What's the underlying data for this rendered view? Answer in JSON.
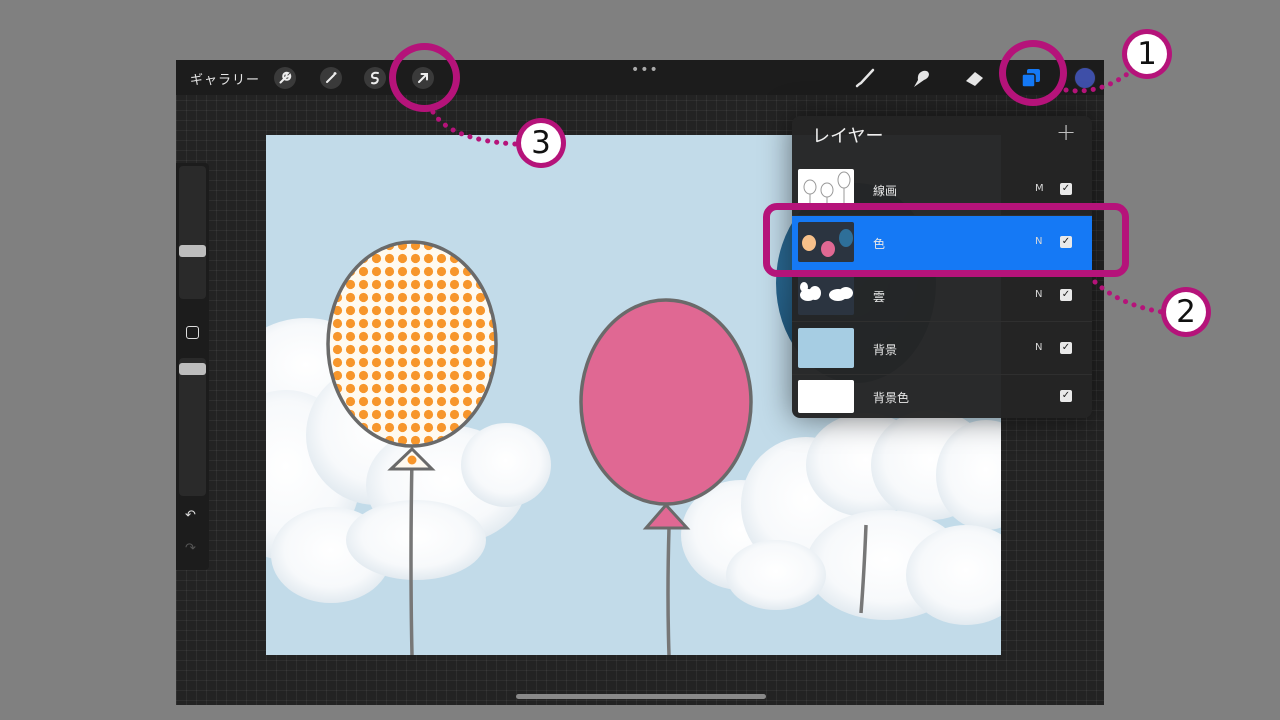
{
  "toolbar": {
    "gallery_label": "ギャラリー",
    "more_label": "•••",
    "icons": [
      "wrench-icon",
      "magic-wand-icon",
      "selection-icon",
      "transform-arrow-icon",
      "brush-icon",
      "smudge-icon",
      "eraser-icon",
      "layers-icon"
    ],
    "current_color": "#3e4fa8"
  },
  "sidebar": {
    "icons": [
      "modify-square-icon",
      "undo-icon",
      "redo-icon"
    ],
    "undo_glyph": "↶",
    "redo_glyph": "↷"
  },
  "layers_panel": {
    "title": "レイヤー",
    "add_label": "+",
    "layers": [
      {
        "name": "線画",
        "blend": "M",
        "visible": true,
        "active": false
      },
      {
        "name": "色",
        "blend": "N",
        "visible": true,
        "active": true
      },
      {
        "name": "雲",
        "blend": "N",
        "visible": true,
        "active": false
      },
      {
        "name": "背景",
        "blend": "N",
        "visible": true,
        "active": false
      },
      {
        "name": "背景色",
        "blend": "",
        "visible": true,
        "active": false
      }
    ],
    "check_glyph": "✓"
  },
  "callouts": {
    "badge_1": "1",
    "badge_2": "2",
    "badge_3": "3",
    "color": "#b5137a"
  },
  "colors": {
    "accent_blue": "#1579f5",
    "sky": "#c2dbe9",
    "balloon_pink": "#e06893",
    "balloon_orange": "#f7962b",
    "balloon_blue": "#2e6f99"
  }
}
